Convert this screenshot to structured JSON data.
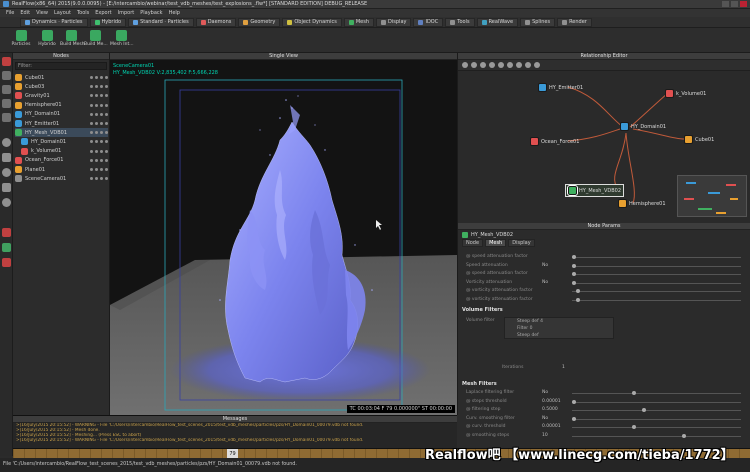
{
  "window": {
    "title": "RealFlow(x86_64) 2015(9.0.0.0095) - [E:/intercambio/webinar/test_vdb_meshes/test_explosions_.flw*] [STANDARD EDITION] DEBUG_RELEASE"
  },
  "menu": [
    "File",
    "Edit",
    "View",
    "Layout",
    "Tools",
    "Export",
    "Import",
    "Playback",
    "Help"
  ],
  "tabs": [
    {
      "label": "Dynamics · Particles",
      "color": "#5fa0e0"
    },
    {
      "label": "Hybrido",
      "color": "#3fbf6f"
    },
    {
      "label": "Standard · Particles",
      "color": "#5fa0e0"
    },
    {
      "label": "Daemons",
      "color": "#e05a5a"
    },
    {
      "label": "Geometry",
      "color": "#e0a040"
    },
    {
      "label": "Object Dynamics",
      "color": "#d0c040"
    },
    {
      "label": "Mesh",
      "color": "#40b060"
    },
    {
      "label": "Display",
      "color": "#909090"
    },
    {
      "label": "IDOC",
      "color": "#6080c0"
    },
    {
      "label": "Tools",
      "color": "#909090"
    },
    {
      "label": "RealWave",
      "color": "#40a0c0"
    },
    {
      "label": "Splines",
      "color": "#909090"
    },
    {
      "label": "Render",
      "color": "#909090"
    }
  ],
  "toolbar": [
    {
      "label": "Particles",
      "color": "#3aa860"
    },
    {
      "label": "Hybrido",
      "color": "#3aa860"
    },
    {
      "label": "Build Mesh",
      "color": "#3aa860"
    },
    {
      "label": "Build Me...",
      "color": "#3aa860"
    },
    {
      "label": "Mesh Int...",
      "color": "#3aa860"
    }
  ],
  "nodes_panel": {
    "title": "Nodes",
    "filter_label": "Filter:",
    "items": [
      {
        "label": "Cube01",
        "icon": "cube-icon",
        "color": "#e8a030"
      },
      {
        "label": "Cube03",
        "icon": "cube-icon",
        "color": "#e8a030"
      },
      {
        "label": "Gravity01",
        "icon": "gravity-icon",
        "color": "#e05050"
      },
      {
        "label": "Hemisphere01",
        "icon": "hemisphere-icon",
        "color": "#e8a030"
      },
      {
        "label": "HY_Domain01",
        "icon": "domain-icon",
        "color": "#3a9ad8"
      },
      {
        "label": "HY_Emitter01",
        "icon": "emitter-icon",
        "color": "#3a9ad8"
      },
      {
        "label": "HY_Mesh_VDB01",
        "icon": "mesh-icon",
        "color": "#40b060"
      },
      {
        "label": "HY_Domain01",
        "icon": "domain-icon",
        "color": "#3a9ad8"
      },
      {
        "label": "k_Volume01",
        "icon": "volume-icon",
        "color": "#e05050"
      },
      {
        "label": "Ocean_Force01",
        "icon": "force-icon",
        "color": "#e05050"
      },
      {
        "label": "Plane01",
        "icon": "plane-icon",
        "color": "#e8a030"
      },
      {
        "label": "SceneCamera01",
        "icon": "camera-icon",
        "color": "#909090"
      }
    ]
  },
  "viewport": {
    "title": "Single View",
    "camera_label": "SceneCamera01",
    "mesh_info": "HY_Mesh_VDB02 V:2,835,402 F:5,666,228",
    "stats": "TC 00:03:04  F 79  0.000000\"  ST 00:00:00"
  },
  "relationship_editor": {
    "title": "Relationship Editor",
    "nodes": [
      {
        "label": "HY_Emitter01",
        "color": "#3a9ad8"
      },
      {
        "label": "k_Volume01",
        "color": "#e05050"
      },
      {
        "label": "HY_Domain01",
        "color": "#3a9ad8"
      },
      {
        "label": "Ocean_Force01",
        "color": "#e05050"
      },
      {
        "label": "Cube01",
        "color": "#e8a030"
      },
      {
        "label": "HY_Mesh_VDB02",
        "color": "#40b060"
      },
      {
        "label": "Hemisphere01",
        "color": "#e8a030"
      }
    ]
  },
  "node_params": {
    "title": "Node Params",
    "node_name": "HY_Mesh_VDB02",
    "tabs": [
      "Node",
      "Mesh",
      "Display"
    ],
    "active_tab": "Mesh",
    "rows_top": [
      {
        "label": "@ speed attenuation factor",
        "value": ""
      },
      {
        "label": "Speed attenuation",
        "value": "No"
      },
      {
        "label": "@ speed attenuation factor",
        "value": ""
      },
      {
        "label": "Vorticity attenuation",
        "value": "No"
      },
      {
        "label": "@ vorticity attenuation factor",
        "value": ""
      },
      {
        "label": "@ vorticity attenuation factor",
        "value": ""
      }
    ],
    "volume_filters_title": "Volume Filters",
    "volume_filter_label": "Volume filter",
    "volume_filters": [
      "Steep def 4",
      "Filter 0",
      "Steep def"
    ],
    "iterations_label": "Iterations",
    "iterations_value": "1",
    "mesh_filters_title": "Mesh Filters",
    "mesh_rows": [
      {
        "label": "Laplace filtering filter",
        "value": "No"
      },
      {
        "label": "@ steps threshold",
        "value": "0.00001"
      },
      {
        "label": "@ filtering step",
        "value": "0.5000"
      },
      {
        "label": "Curv. smoothing filter",
        "value": "No"
      },
      {
        "label": "@ curv. threshold",
        "value": "0.00001"
      },
      {
        "label": "@ smoothing steps",
        "value": "10"
      }
    ]
  },
  "messages": {
    "title": "Messages",
    "lines": [
      ">[16/July/2015 20:15:52] - WARNING - File 'C:/Users/intercambio/RealFlow_test_scenes_2015/test_vdb_meshes/particles/pzs/HY_Domain01_00079.vdb not found.",
      ">[16/July/2015 20:15:52] - Mesh done.",
      ">[16/July/2015 20:15:52] - Meshing... (Press ESC to abort)",
      ">[16/July/2015 20:15:52] - WARNING - File 'C:/Users/intercambio/RealFlow_test_scenes_2015/test_vdb_meshes/particles/pzs/HY_Domain01_00079.vdb not found."
    ]
  },
  "timeline": {
    "current_frame": "79"
  },
  "statusbar": {
    "text": "File 'C:/Users/intercambio/RealFlow_test_scenes_2015/test_vdb_meshes/particles/pzs/HY_Domain01_00079.vdb not found."
  },
  "watermark": {
    "text": "Realflow吧 【www.linecg.com/tieba/1772】"
  }
}
